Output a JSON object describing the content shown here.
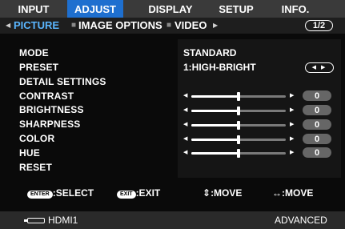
{
  "tabs": [
    {
      "label": "INPUT",
      "active": false
    },
    {
      "label": "ADJUST",
      "active": true
    },
    {
      "label": "DISPLAY",
      "active": false
    },
    {
      "label": "SETUP",
      "active": false
    },
    {
      "label": "INFO.",
      "active": false
    }
  ],
  "subtabs": {
    "left_arrow": "◀",
    "items": [
      "PICTURE",
      "IMAGE OPTIONS",
      "VIDEO"
    ],
    "separator": "■",
    "right_arrow": "▶",
    "page": "1/2"
  },
  "settings": [
    {
      "label": "MODE",
      "value": "STANDARD"
    },
    {
      "label": "PRESET",
      "value": "1:HIGH-BRIGHT",
      "button": "◀ ▶"
    },
    {
      "label": "DETAIL SETTINGS"
    },
    {
      "label": "CONTRAST",
      "slider": {
        "value": "0",
        "level": 0.5
      }
    },
    {
      "label": "BRIGHTNESS",
      "slider": {
        "value": "0",
        "level": 0.5
      }
    },
    {
      "label": "SHARPNESS",
      "slider": {
        "value": "0",
        "level": 0.5
      }
    },
    {
      "label": "COLOR",
      "slider": {
        "value": "0",
        "level": 0.5
      }
    },
    {
      "label": "HUE",
      "slider": {
        "value": "0",
        "level": 0.5
      }
    },
    {
      "label": "RESET"
    }
  ],
  "hints": {
    "enter_key": "ENTER",
    "enter_action": ":SELECT",
    "exit_key": "EXIT",
    "exit_action": ":EXIT",
    "move_updown_icon": "⇕",
    "move_updown": ":MOVE",
    "move_leftright_icon": "↔",
    "move_leftright": ":MOVE"
  },
  "status": {
    "source": "HDMI1",
    "source_icon": "hdmi-connector-icon",
    "mode": "ADVANCED"
  },
  "colors": {
    "active_tab": "#1e6fcf",
    "active_subtab": "#5ab6ff"
  }
}
